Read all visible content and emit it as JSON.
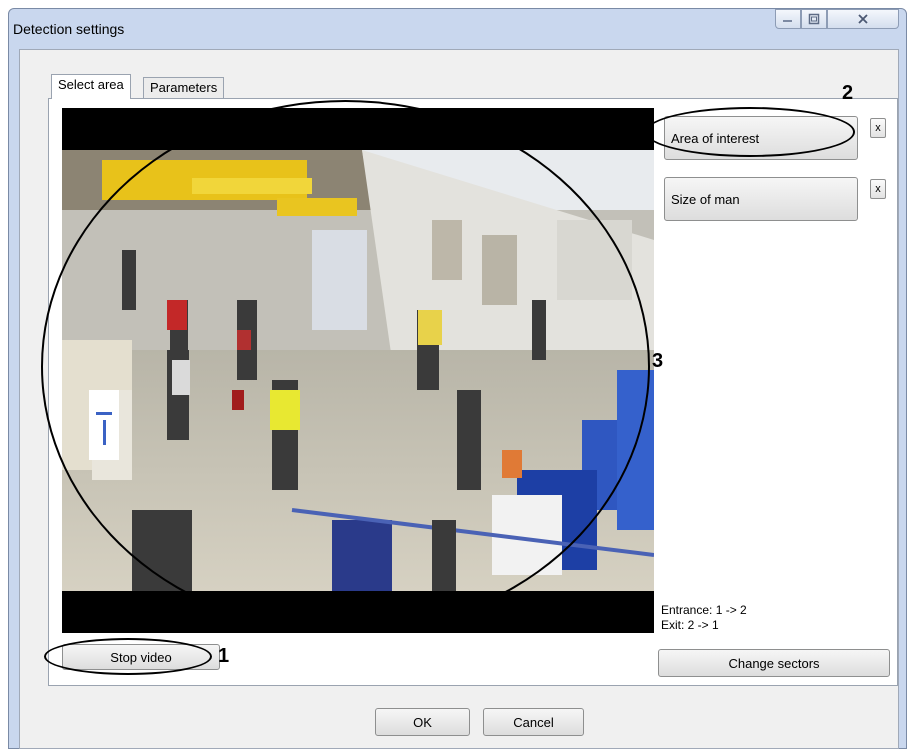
{
  "window": {
    "title": "Detection settings"
  },
  "tabs": [
    {
      "label": "Select area",
      "active": true
    },
    {
      "label": "Parameters",
      "active": false
    }
  ],
  "sidebar": {
    "area_button": "Area of interest",
    "size_button": "Size of man",
    "remove_label": "x"
  },
  "info": {
    "entrance": "Entrance: 1 -> 2",
    "exit": "Exit: 2 -> 1"
  },
  "buttons": {
    "stop_video": "Stop video",
    "change_sectors": "Change sectors",
    "ok": "OK",
    "cancel": "Cancel"
  },
  "annotations": {
    "n1": "1",
    "n2": "2",
    "n3": "3"
  },
  "icons": {
    "minimize": "minimize-icon",
    "maximize": "maximize-icon",
    "close": "close-icon"
  }
}
